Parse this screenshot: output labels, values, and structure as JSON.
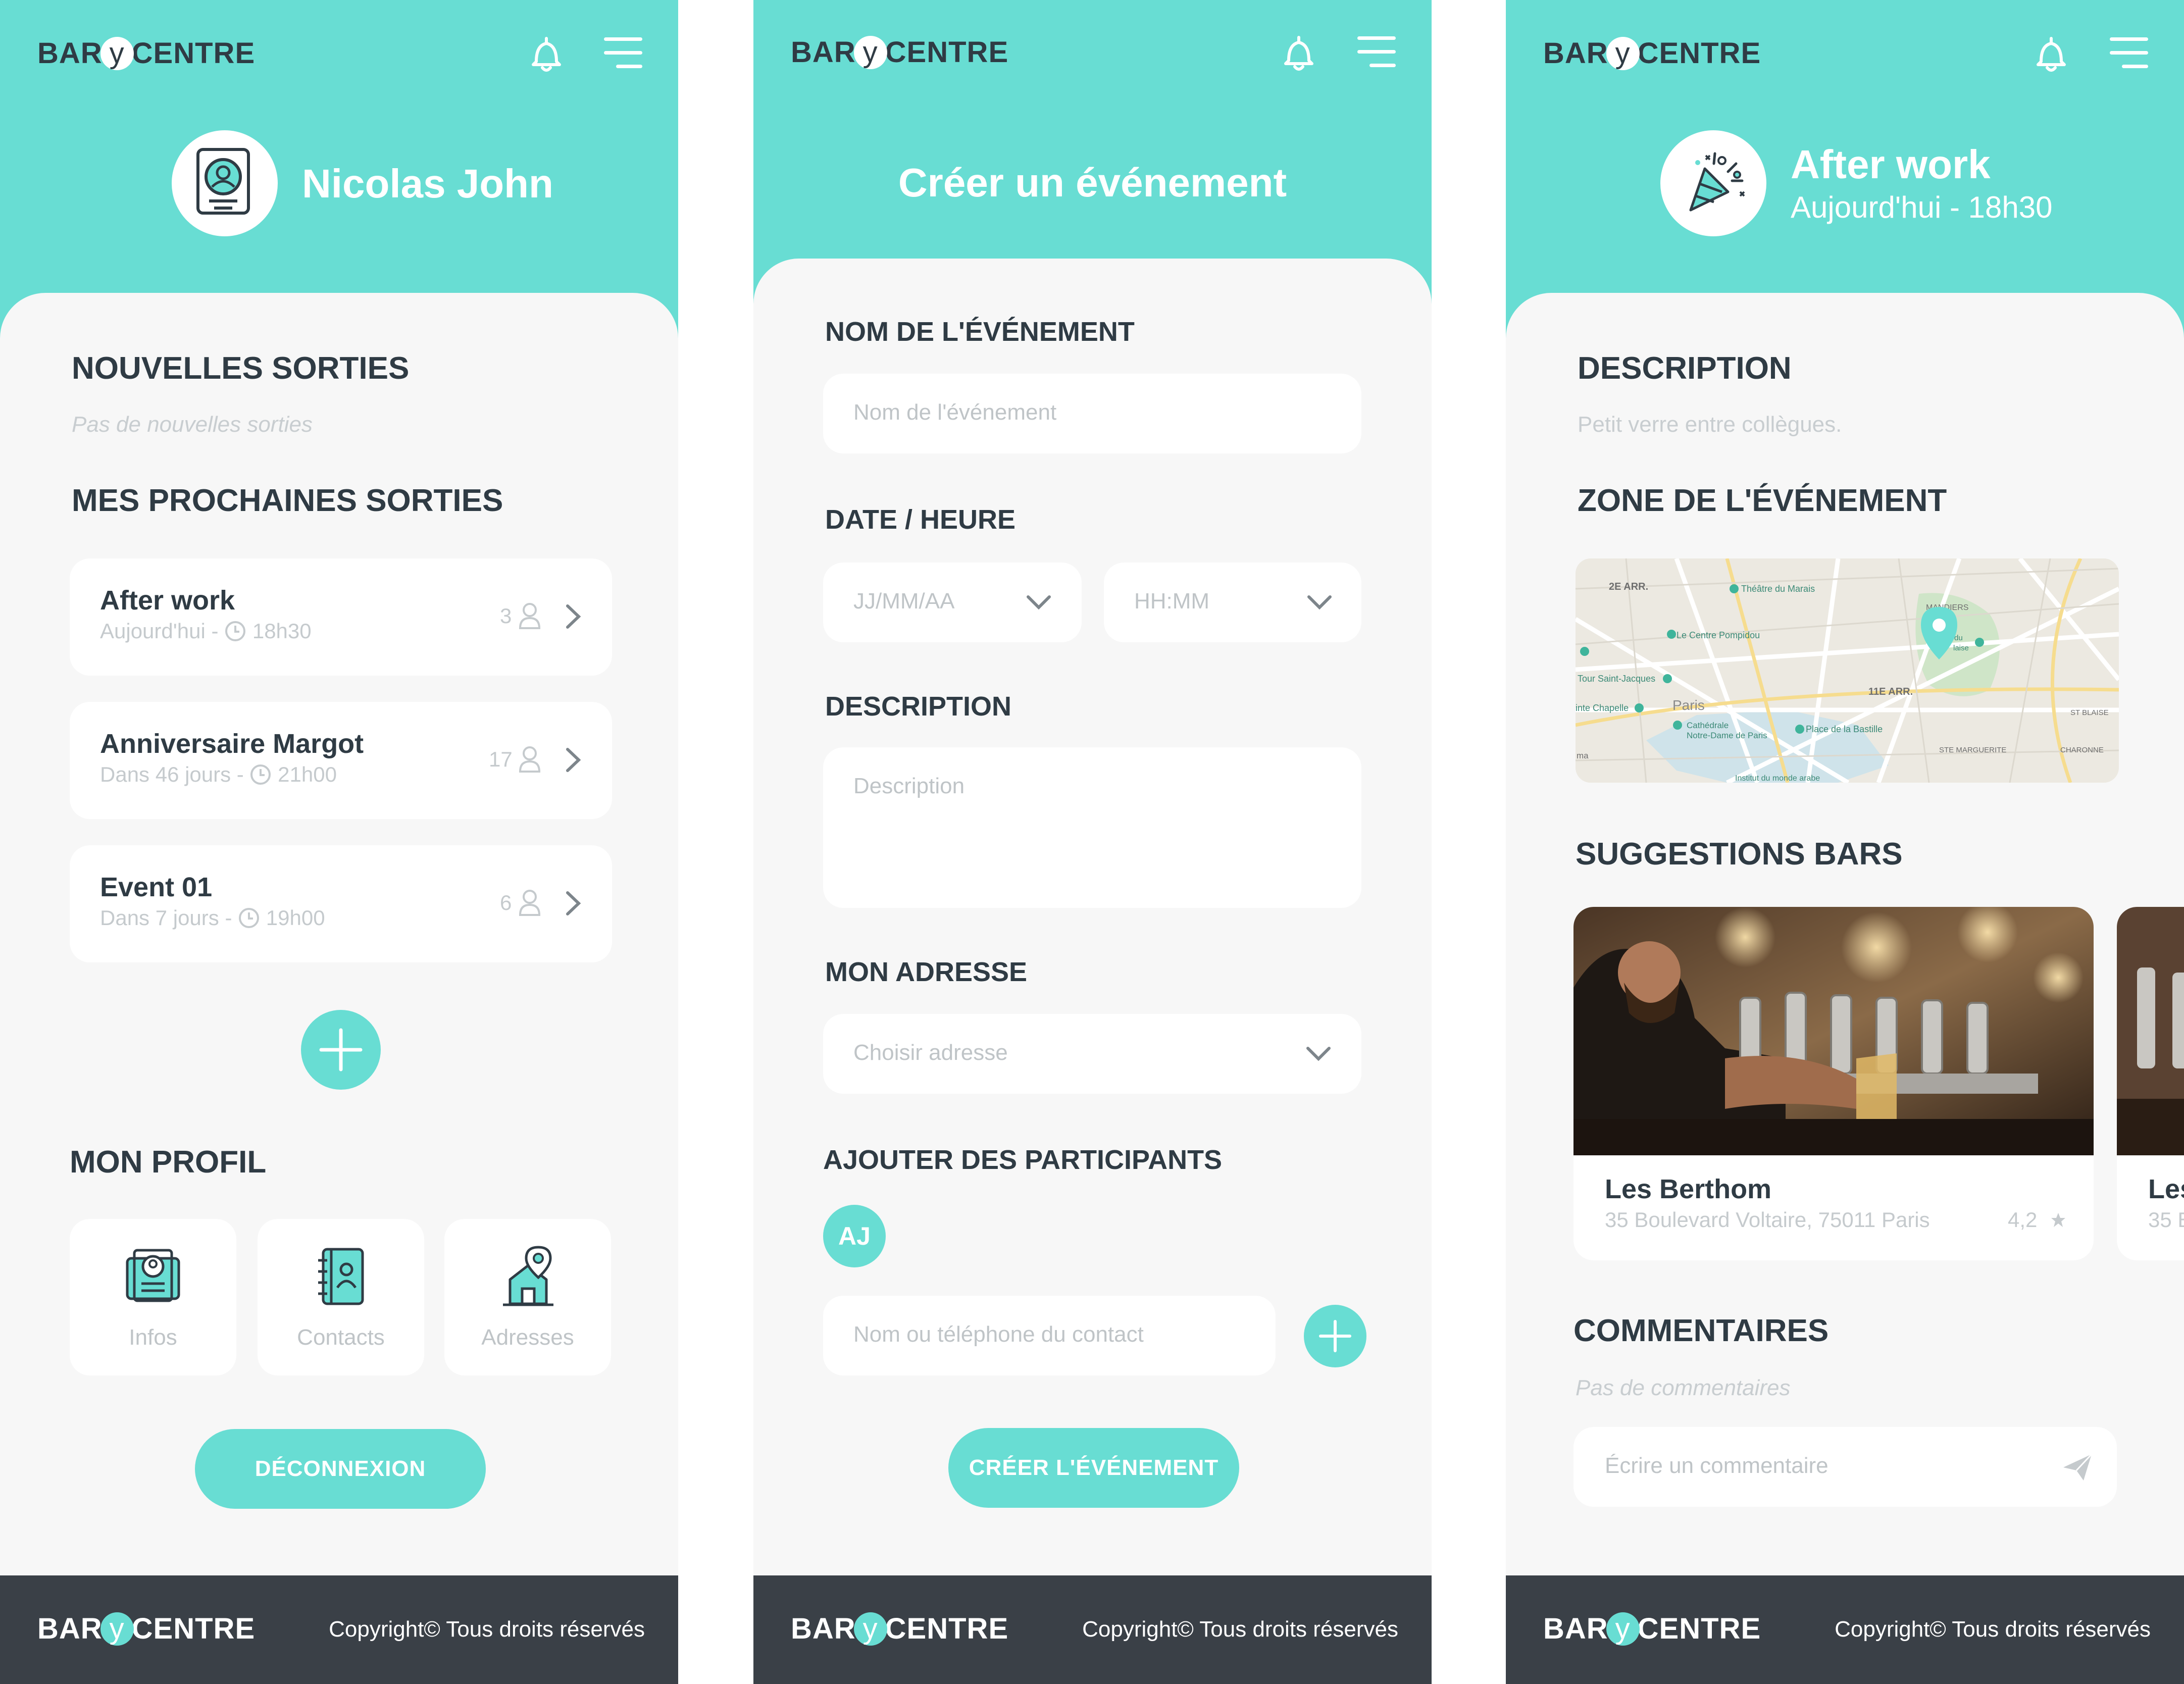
{
  "brand": {
    "logo_left": "BAR",
    "logo_mid": "y",
    "logo_right": "CENTRE",
    "accent": "#68ddd3",
    "dark": "#3a4047"
  },
  "footer": {
    "copyright": "Copyright© Tous droits réservés"
  },
  "profile_screen": {
    "user_name": "Nicolas John",
    "new_outings_title": "NOUVELLES SORTIES",
    "new_outings_empty": "Pas de nouvelles sorties",
    "upcoming_title": "MES PROCHAINES SORTIES",
    "events": [
      {
        "title": "After work",
        "when": "Aujourd'hui -",
        "time": "18h30",
        "participants": "3"
      },
      {
        "title": "Anniversaire Margot",
        "when": "Dans 46 jours -",
        "time": "21h00",
        "participants": "17"
      },
      {
        "title": "Event 01",
        "when": "Dans 7 jours -",
        "time": "19h00",
        "participants": "6"
      }
    ],
    "my_profile_title": "MON PROFIL",
    "tiles": [
      {
        "label": "Infos"
      },
      {
        "label": "Contacts"
      },
      {
        "label": "Adresses"
      }
    ],
    "logout_label": "DÉCONNEXION"
  },
  "create_screen": {
    "title": "Créer un événement",
    "name_label": "NOM DE L'ÉVÉNEMENT",
    "name_placeholder": "Nom de l'événement",
    "datetime_label": "DATE / HEURE",
    "date_placeholder": "JJ/MM/AA",
    "time_placeholder": "HH:MM",
    "description_label": "DESCRIPTION",
    "description_placeholder": "Description",
    "address_label": "MON ADRESSE",
    "address_placeholder": "Choisir adresse",
    "participants_label": "AJOUTER DES PARTICIPANTS",
    "participant_initials": "AJ",
    "contact_placeholder": "Nom ou téléphone du contact",
    "submit_label": "CRÉER L'ÉVÉNEMENT"
  },
  "event_screen": {
    "title": "After work",
    "subtitle": "Aujourd'hui - 18h30",
    "description_title": "DESCRIPTION",
    "description_text": "Petit verre entre collègues.",
    "zone_title": "ZONE DE L'ÉVÉNEMENT",
    "map_labels": {
      "arr2": "2E ARR.",
      "marais": "Théâtre du Marais",
      "mandiers": "MANDIERS",
      "pompidou": "Le Centre Pompidou",
      "tour": "Tour Saint-Jacques",
      "arr11": "11E ARR.",
      "paris": "Paris",
      "chapelle": "inte Chapelle",
      "notre_dame_1": "Cathédrale",
      "notre_dame_2": "Notre-Dame de Paris",
      "bastille": "Place de la Bastille",
      "st_blaise": "ST BLAISE",
      "ste_marguerite": "STE MARGUERITE",
      "charonne": "CHARONNE",
      "institut": "Institut du monde arabe",
      "ma": "ma",
      "du": "du",
      "laise": "laise"
    },
    "suggestions_title": "SUGGESTIONS BARS",
    "bars": [
      {
        "name": "Les Berthom",
        "address": "35 Boulevard Voltaire, 75011 Paris",
        "rating": "4,2"
      },
      {
        "name": "Les",
        "address": "35 E"
      }
    ],
    "comments_title": "COMMENTAIRES",
    "comments_empty": "Pas de commentaires",
    "comment_placeholder": "Écrire un commentaire"
  }
}
